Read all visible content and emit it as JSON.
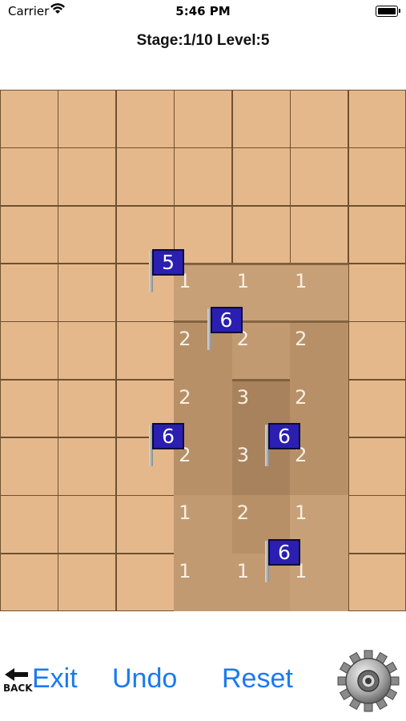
{
  "status_bar": {
    "carrier": "Carrier",
    "time": "5:46 PM"
  },
  "header": {
    "stage_text": "Stage:1/10 Level:5"
  },
  "board": {
    "columns": 7,
    "rows": 9,
    "open_cells": [
      {
        "row": 3,
        "col": 3,
        "num": "1",
        "shade": "#c8a078"
      },
      {
        "row": 3,
        "col": 4,
        "num": "1",
        "shade": "#c8a078"
      },
      {
        "row": 3,
        "col": 5,
        "num": "1",
        "shade": "#c8a078"
      },
      {
        "row": 4,
        "col": 3,
        "num": "2",
        "shade": "#b89068"
      },
      {
        "row": 4,
        "col": 4,
        "num": "2",
        "shade": "#c29a72"
      },
      {
        "row": 4,
        "col": 5,
        "num": "2",
        "shade": "#b89068"
      },
      {
        "row": 5,
        "col": 3,
        "num": "2",
        "shade": "#b89068"
      },
      {
        "row": 5,
        "col": 4,
        "num": "3",
        "shade": "#a8825c"
      },
      {
        "row": 5,
        "col": 5,
        "num": "2",
        "shade": "#b89068"
      },
      {
        "row": 6,
        "col": 3,
        "num": "2",
        "shade": "#b89068"
      },
      {
        "row": 6,
        "col": 4,
        "num": "3",
        "shade": "#a8825c"
      },
      {
        "row": 6,
        "col": 5,
        "num": "2",
        "shade": "#b89068"
      },
      {
        "row": 7,
        "col": 3,
        "num": "1",
        "shade": "#c29a72"
      },
      {
        "row": 7,
        "col": 4,
        "num": "2",
        "shade": "#b89068"
      },
      {
        "row": 7,
        "col": 5,
        "num": "1",
        "shade": "#c8a078"
      },
      {
        "row": 8,
        "col": 3,
        "num": "1",
        "shade": "#c29a72"
      },
      {
        "row": 8,
        "col": 4,
        "num": "1",
        "shade": "#c29a72"
      },
      {
        "row": 8,
        "col": 5,
        "num": "1",
        "shade": "#c8a078"
      }
    ],
    "flags": [
      {
        "row": 3,
        "col": 2,
        "label": "5"
      },
      {
        "row": 4,
        "col": 3,
        "label": "6"
      },
      {
        "row": 6,
        "col": 2,
        "label": "6"
      },
      {
        "row": 6,
        "col": 4,
        "label": "6"
      },
      {
        "row": 8,
        "col": 4,
        "label": "6"
      }
    ],
    "colors": {
      "tile": "#e5b88b",
      "grid_line": "#6f5030",
      "flag": "#2a1fb0"
    }
  },
  "controls": {
    "back_icon": "back-arrow-icon",
    "back_label": "BACK",
    "exit_label": "Exit",
    "undo_label": "Undo",
    "reset_label": "Reset",
    "settings_icon": "gear-icon"
  },
  "accent_color": "#1a7af0"
}
